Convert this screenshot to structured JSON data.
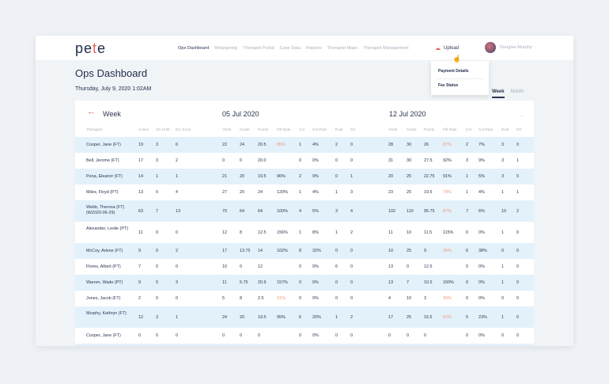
{
  "header": {
    "logo": "pete",
    "nav": [
      "Ops Dashboard",
      "Retargeting",
      "Therapist Portal",
      "Case Data",
      "Reports",
      "Therapist Maps",
      "Therapist Management"
    ],
    "upload": "Upload",
    "user": "Douglas Murphy"
  },
  "menu": {
    "items": [
      "Payment Details",
      "Fax Status"
    ]
  },
  "page": {
    "title": "Ops Dashboard",
    "date": "Thursday, July 9, 2020 1:02AM"
  },
  "tabs": [
    "Week",
    "Month"
  ],
  "table": {
    "period_label": "Week",
    "week1": "05 Jul 2020",
    "week2": "12 Jul 2020",
    "columns": [
      "Therapist",
      "Active",
      "On Hold",
      "DC Soon",
      "Visits",
      "Goals",
      "Points",
      "Fill Rate",
      "Cxl",
      "Cxl Rate",
      "Eval",
      "DC",
      "Visits",
      "Goals",
      "Points",
      "Fill Rate",
      "Cxl",
      "Cxl Rate",
      "Eval",
      "DC"
    ],
    "warn_color": "#ef9a78",
    "rows": [
      {
        "cells": [
          "Cooper, Jane (FT)",
          "19",
          "3",
          "6",
          "22",
          "24",
          "20.5",
          "85%",
          "1",
          "4%",
          "2",
          "0",
          "28",
          "30",
          "26",
          "87%",
          "2",
          "7%",
          "3",
          "0"
        ],
        "warn": [
          7,
          15
        ]
      },
      {
        "cells": [
          "Bell, Jerome (FT)",
          "17",
          "3",
          "2",
          "0",
          "0",
          "20.0",
          "",
          "0",
          "0%",
          "0",
          "0",
          "31",
          "30",
          "27.5",
          "92%",
          "3",
          "9%",
          "3",
          "1"
        ],
        "warn": []
      },
      {
        "cells": [
          "Pena, Eleanor (FT)",
          "14",
          "1",
          "1",
          "21",
          "20",
          "19.5",
          "96%",
          "2",
          "9%",
          "0",
          "1",
          "20",
          "25",
          "22.75",
          "91%",
          "1",
          "5%",
          "3",
          "0"
        ],
        "warn": []
      },
      {
        "cells": [
          "Miles, Floyd (PT)",
          "13",
          "0",
          "4",
          "27",
          "20",
          "24",
          "120%",
          "1",
          "4%",
          "1",
          "3",
          "23",
          "25",
          "19.5",
          "78%",
          "1",
          "4%",
          "1",
          "1"
        ],
        "warn": [
          15
        ]
      },
      {
        "cells": [
          "Webb, Theresa (FT) (W2020-06-29)",
          "63",
          "7",
          "13",
          "70",
          "64",
          "64",
          "100%",
          "4",
          "5%",
          "3",
          "4",
          "102",
          "110",
          "95.75",
          "87%",
          "7",
          "6%",
          "10",
          "2"
        ],
        "warn": [
          15
        ],
        "tall": true
      },
      {
        "cells": [
          "Alexander, Leslie (PT)",
          "11",
          "0",
          "0",
          "12",
          "8",
          "12.5",
          "156%",
          "1",
          "8%",
          "1",
          "2",
          "11",
          "10",
          "11.5",
          "115%",
          "0",
          "0%",
          "1",
          "0"
        ],
        "warn": [],
        "tall": true
      },
      {
        "cells": [
          "McCoy, Arlene (FT)",
          "9",
          "0",
          "2",
          "17",
          "13.75",
          "14",
          "102%",
          "8",
          "32%",
          "0",
          "0",
          "10",
          "25",
          "9",
          "36%",
          "6",
          "38%",
          "0",
          "0"
        ],
        "warn": [
          15
        ]
      },
      {
        "cells": [
          "Flores, Albert (PT)",
          "7",
          "0",
          "0",
          "10",
          "0",
          "12",
          "",
          "0",
          "0%",
          "6",
          "0",
          "13",
          "0",
          "12.5",
          "",
          "0",
          "0%",
          "1",
          "0"
        ],
        "warn": []
      },
      {
        "cells": [
          "Warren, Wade (PT)",
          "9",
          "0",
          "3",
          "11",
          "5.75",
          "20.9",
          "157%",
          "0",
          "0%",
          "0",
          "0",
          "13",
          "7",
          "10.5",
          "150%",
          "0",
          "0%",
          "1",
          "0"
        ],
        "warn": []
      },
      {
        "cells": [
          "Jones, Jacob (FT)",
          "2",
          "0",
          "0",
          "5",
          "8",
          "2.5",
          "31%",
          "0",
          "0%",
          "0",
          "0",
          "4",
          "10",
          "3",
          "30%",
          "0",
          "0%",
          "0",
          "0"
        ],
        "warn": [
          7,
          15
        ]
      },
      {
        "cells": [
          "Murphy, Kathryn (FT)",
          "12",
          "3",
          "1",
          "24",
          "20",
          "19.5",
          "95%",
          "6",
          "20%",
          "1",
          "2",
          "17",
          "25",
          "15.5",
          "62%",
          "5",
          "23%",
          "1",
          "0"
        ],
        "warn": [
          15
        ],
        "tall": true
      },
      {
        "cells": [
          "Cooper, Jane (FT)",
          "0",
          "0",
          "0",
          "0",
          "0",
          "0",
          "",
          "0",
          "0%",
          "0",
          "0",
          "0",
          "0",
          "0",
          "",
          "0",
          "0%",
          "0",
          "0"
        ],
        "warn": []
      }
    ]
  }
}
